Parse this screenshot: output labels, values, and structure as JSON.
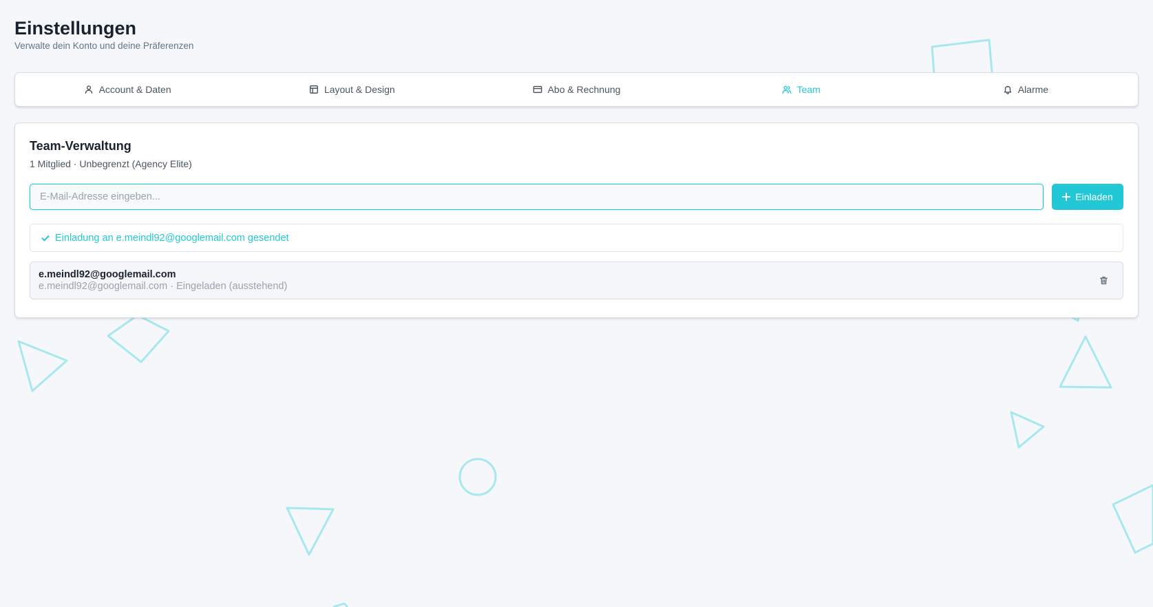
{
  "header": {
    "title": "Einstellungen",
    "subtitle": "Verwalte dein Konto und deine Präferenzen"
  },
  "tabs": [
    {
      "label": "Account & Daten",
      "icon": "user-icon",
      "active": false
    },
    {
      "label": "Layout & Design",
      "icon": "layout-icon",
      "active": false
    },
    {
      "label": "Abo & Rechnung",
      "icon": "credit-card-icon",
      "active": false
    },
    {
      "label": "Team",
      "icon": "users-icon",
      "active": true
    },
    {
      "label": "Alarme",
      "icon": "bell-icon",
      "active": false
    }
  ],
  "team": {
    "title": "Team-Verwaltung",
    "subtitle": "1 Mitglied · Unbegrenzt (Agency Elite)",
    "input": {
      "value": "",
      "placeholder": "E-Mail-Adresse eingeben..."
    },
    "invite_label": "Einladen",
    "success_message": "Einladung an e.meindl92@googlemail.com gesendet",
    "members": [
      {
        "email": "e.meindl92@googlemail.com",
        "meta": "e.meindl92@googlemail.com · Eingeladen (ausstehend)"
      }
    ]
  },
  "colors": {
    "accent": "#22c8d6",
    "background": "#f5f7fa",
    "decor": "#a6e8ee"
  }
}
